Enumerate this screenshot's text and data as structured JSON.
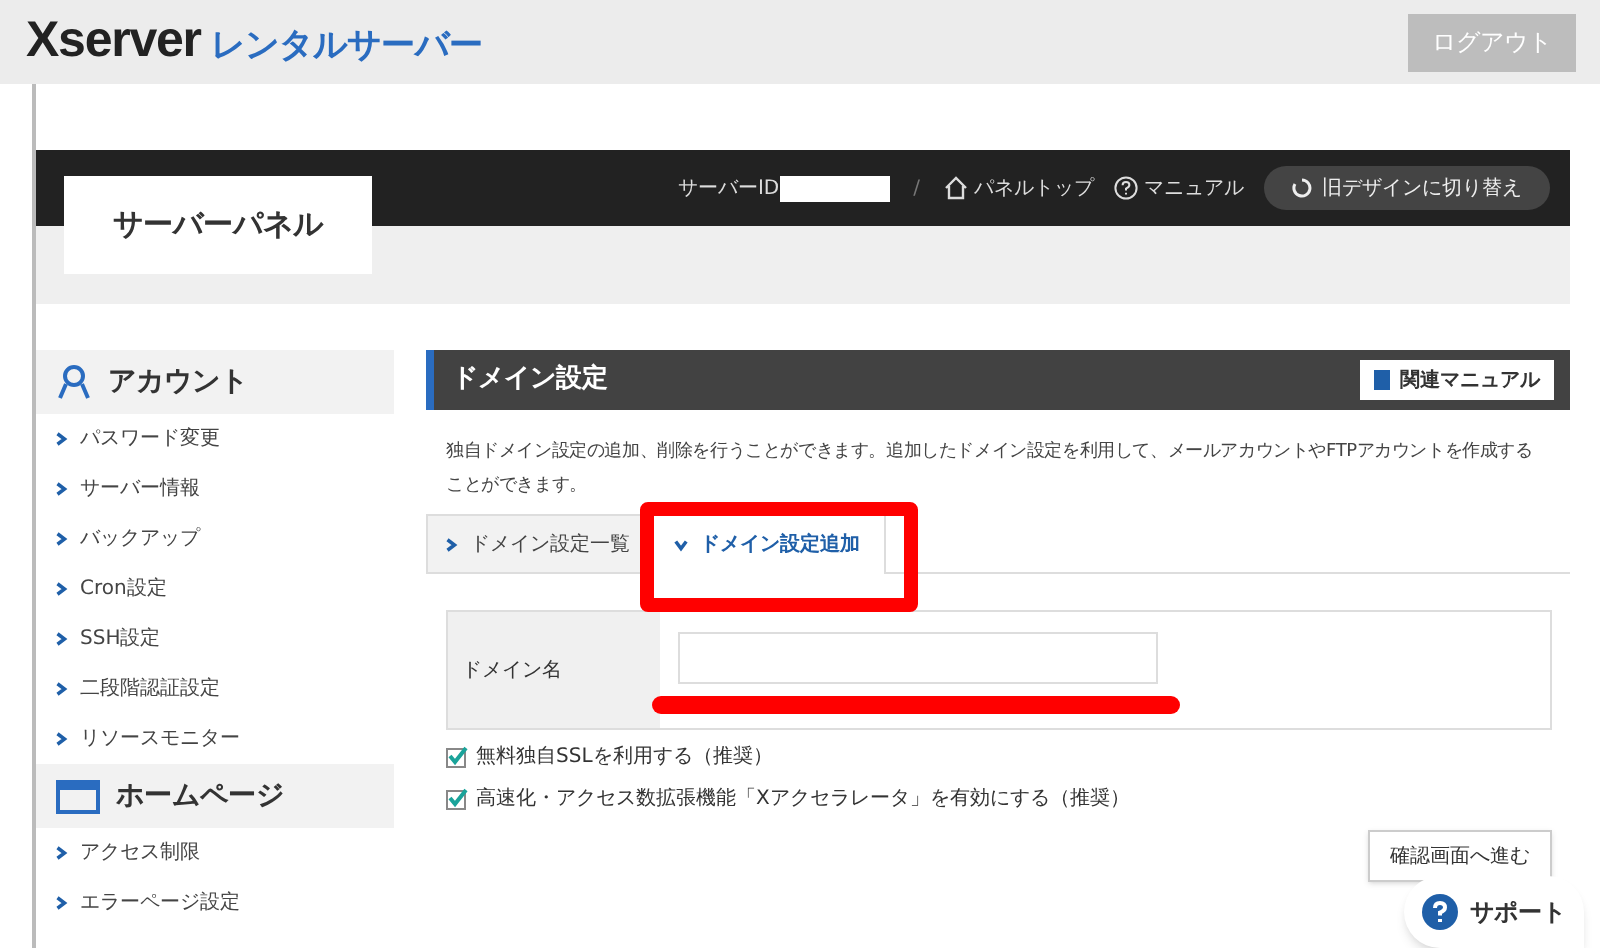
{
  "header": {
    "logo_main": "Xserver",
    "logo_sub": "レンタルサーバー",
    "logout": "ログアウト"
  },
  "panel": {
    "title": "サーバーパネル",
    "server_id_label": "サーバーID",
    "separator": "/",
    "links": [
      {
        "kind": "home",
        "label": "パネルトップ"
      },
      {
        "kind": "help",
        "label": "マニュアル"
      }
    ],
    "switch_button": "旧デザインに切り替え"
  },
  "sidebar": {
    "sections": [
      {
        "kind": "account",
        "title": "アカウント",
        "items": [
          "パスワード変更",
          "サーバー情報",
          "バックアップ",
          "Cron設定",
          "SSH設定",
          "二段階認証設定",
          "リソースモニター"
        ]
      },
      {
        "kind": "homepage",
        "title": "ホームページ",
        "items": [
          "アクセス制限",
          "エラーページ設定"
        ]
      }
    ]
  },
  "main": {
    "title": "ドメイン設定",
    "manual_button": "関連マニュアル",
    "description": "独自ドメイン設定の追加、削除を行うことができます。追加したドメイン設定を利用して、メールアカウントやFTPアカウントを作成することができます。",
    "tabs": [
      {
        "label": "ドメイン設定一覧",
        "selected": false
      },
      {
        "label": "ドメイン設定追加",
        "selected": true
      }
    ],
    "form": {
      "label": "ドメイン名"
    },
    "options": [
      {
        "label": "無料独自SSLを利用する（推奨）",
        "checked": true
      },
      {
        "label": "高速化・アクセス数拡張機能「Xアクセラレータ」を有効にする（推奨）",
        "checked": true
      }
    ],
    "submit": "確認画面へ進む"
  },
  "support": "サポート"
}
